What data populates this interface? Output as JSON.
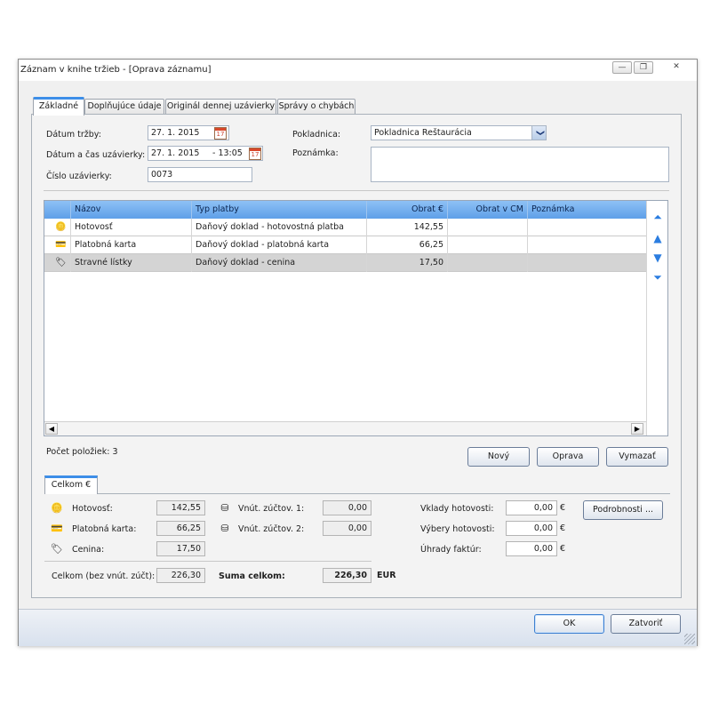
{
  "window": {
    "title": "Záznam v knihe tržieb - [Oprava záznamu]",
    "minimize_glyph": "—",
    "restore_glyph": "❐",
    "close_glyph": "✕"
  },
  "tabs": [
    {
      "label": "Základné",
      "active": true
    },
    {
      "label": "Doplňujúce údaje",
      "active": false
    },
    {
      "label": "Originál dennej uzávierky",
      "active": false
    },
    {
      "label": "Správy o chybách",
      "active": false
    }
  ],
  "form": {
    "datum_trzby_label": "Dátum tržby:",
    "datum_trzby_value": "27. 1. 2015",
    "datum_cas_label": "Dátum a čas uzávierky:",
    "datum_cas_date": "27. 1. 2015",
    "datum_cas_time": "- 13:05",
    "cislo_label": "Číslo uzávierky:",
    "cislo_value": "0073",
    "pokladnica_label": "Pokladnica:",
    "pokladnica_value": "Pokladnica Reštaurácia",
    "poznamka_label": "Poznámka:",
    "poznamka_value": "",
    "calendar_glyph": "17",
    "dropdown_glyph": "❯"
  },
  "grid": {
    "columns": [
      "Názov",
      "Typ platby",
      "Obrat €",
      "Obrat v CM",
      "Poznámka"
    ],
    "rows": [
      {
        "icon": "coins-icon",
        "glyph": "🪙",
        "nazov": "Hotovosť",
        "typ": "Daňový doklad - hotovostná platba",
        "obrat": "142,55",
        "obrat_cm": "",
        "poznamka": ""
      },
      {
        "icon": "card-icon",
        "glyph": "💳",
        "nazov": "Platobná karta",
        "typ": "Daňový doklad - platobná karta",
        "obrat": "66,25",
        "obrat_cm": "",
        "poznamka": ""
      },
      {
        "icon": "tag-icon",
        "glyph": "🏷",
        "nazov": "Stravné lístky",
        "typ": "Daňový doklad - cenina",
        "obrat": "17,50",
        "obrat_cm": "",
        "poznamka": ""
      }
    ],
    "scroll_left": "◀",
    "scroll_right": "▶",
    "nav_first": "⏶",
    "nav_up": "▲",
    "nav_down": "▼",
    "nav_last": "⏷"
  },
  "count_label": "Počet položiek: 3",
  "actions": {
    "new": "Nový",
    "edit": "Oprava",
    "delete": "Vymazať"
  },
  "summary": {
    "tab_label": "Celkom €",
    "hotovost_label": "Hotovosť:",
    "hotovost_value": "142,55",
    "karta_label": "Platobná karta:",
    "karta_value": "66,25",
    "cenina_label": "Cenina:",
    "cenina_value": "17,50",
    "vnut1_label": "Vnút. zúčtov. 1:",
    "vnut1_value": "0,00",
    "vnut2_label": "Vnút. zúčtov. 2:",
    "vnut2_value": "0,00",
    "celkom_label": "Celkom (bez vnút. zúčt):",
    "celkom_value": "226,30",
    "suma_label": "Suma celkom:",
    "suma_value": "226,30",
    "suma_currency": "EUR",
    "vklady_label": "Vklady hotovosti:",
    "vklady_value": "0,00",
    "vybery_label": "Výbery hotovosti:",
    "vybery_value": "0,00",
    "uhrady_label": "Úhrady faktúr:",
    "uhrady_value": "0,00",
    "currency": "€",
    "details_button": "Podrobnosti ..."
  },
  "footer": {
    "ok": "OK",
    "close": "Zatvoriť"
  }
}
